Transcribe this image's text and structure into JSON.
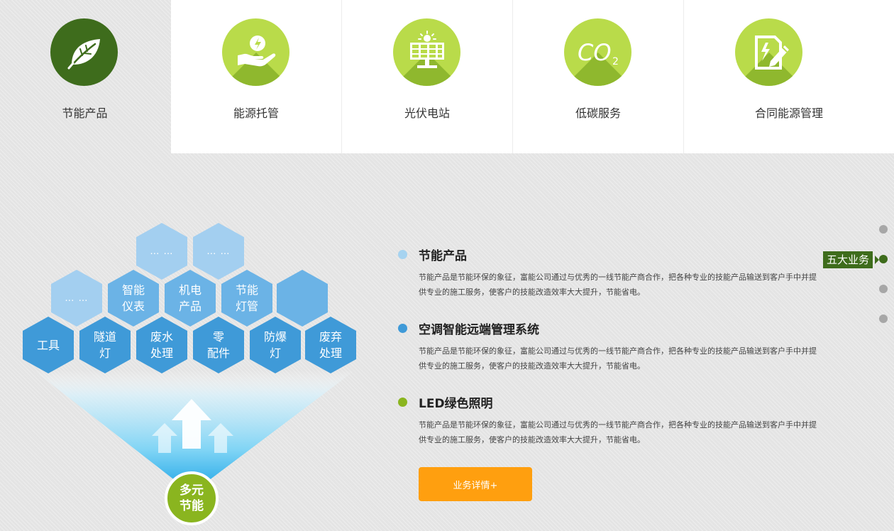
{
  "tabs": [
    {
      "label": "节能产品",
      "icon": "leaf-icon",
      "active": true
    },
    {
      "label": "能源托管",
      "icon": "hand-energy-icon"
    },
    {
      "label": "光伏电站",
      "icon": "solar-panel-icon"
    },
    {
      "label": "低碳服务",
      "icon": "co2-icon"
    },
    {
      "label": "合同能源管理",
      "icon": "contract-pen-icon"
    }
  ],
  "co2_text": {
    "main": "CO",
    "sub": "2"
  },
  "hexagons": {
    "row1": [
      "… …",
      "… …"
    ],
    "row2": [
      "… …",
      "智能\n仪表",
      "机电\n产品",
      "节能\n灯管",
      ""
    ],
    "row3": [
      "工具",
      "隧道\n灯",
      "废水\n处理",
      "零\n配件",
      "防爆\n灯",
      "废弃\n处理"
    ]
  },
  "core_label": "多元\n节能",
  "items": [
    {
      "title": "节能产品",
      "desc": "节能产品是节能环保的象征，富能公司通过与优秀的一线节能产商合作，把各种专业的技能产品输送到客户手中并提供专业的施工服务，使客户的技能改造效率大大提升，节能省电。"
    },
    {
      "title": "空调智能远端管理系统",
      "desc": "节能产品是节能环保的象征，富能公司通过与优秀的一线节能产商合作，把各种专业的技能产品输送到客户手中并提供专业的施工服务，使客户的技能改造效率大大提升，节能省电。"
    },
    {
      "title": "LED绿色照明",
      "desc": "节能产品是节能环保的象征，富能公司通过与优秀的一线节能产商合作，把各种专业的技能产品输送到客户手中并提供专业的施工服务，使客户的技能改造效率大大提升，节能省电。"
    }
  ],
  "colors": {
    "dot1": "#a6d3f0",
    "dot2": "#3f9ad8",
    "dot3": "#8ab51f",
    "accent_green": "#3e6c1c",
    "button": "#ff9f0f"
  },
  "detail_button": "业务详情+",
  "side_nav": {
    "label": "五大业务",
    "active_index": 1,
    "count": 4
  }
}
